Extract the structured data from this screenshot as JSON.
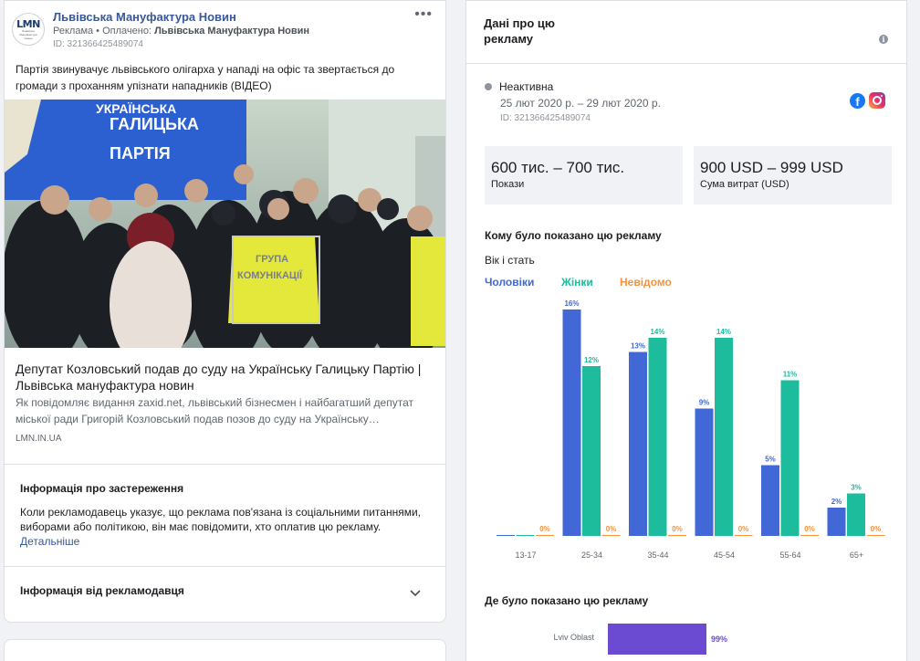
{
  "ad": {
    "page_name": "Львівська Мануфактура Новин",
    "sponsored_prefix": "Реклама • Оплачено: ",
    "paid_by": "Львівська Мануфактура Новин",
    "ad_id": "ID: 321366425489074",
    "logo_text": "LMN",
    "logo_subtext": "Львівська Мануфактура Новин",
    "more_icon": "more-horizontal-icon",
    "body": "Партія звинувачує львівського олігарха у нападі на офіс та звертається до громади з проханням упізнати нападників (ВІДЕО)",
    "image": {
      "banner_line1": "ГАЛИЦЬКА",
      "banner_line2": "ПАРТІЯ",
      "banner_top": "УКРАЇНСЬКА",
      "vest_line1": "ГРУПА",
      "vest_line2": "КОМУНІКАЦІЇ"
    },
    "link_title": "Депутат Козловський подав до суду на Українську Галицьку Партію | Львівська мануфактура новин",
    "link_description": "Як повідомляє видання zaxid.net, львівський бізнесмен і найбагатший депутат міської ради Григорій Козловський подав позов до суду на Українську…",
    "link_domain": "LMN.IN.UA"
  },
  "disclaimer": {
    "title": "Інформація про застереження",
    "text": "Коли рекламодавець указує, що реклама пов'язана із соціальними питаннями, виборами або політикою, він має повідомити, хто оплатив цю рекламу.",
    "link": "Детальніше"
  },
  "advertiser": {
    "title": "Інформація від рекламодавця",
    "chevron_icon": "chevron-down-icon"
  },
  "panel": {
    "title": "Дані про цю рекламу",
    "status": "Неактивна",
    "dates": "25 лют 2020 р. – 29 лют 2020 р.",
    "ad_id": "ID: 321366425489074",
    "platforms": [
      "facebook-icon",
      "instagram-icon"
    ],
    "impressions_value": "600 тис. – 700 тис.",
    "impressions_label": "Покази",
    "spend_value": "900 USD – 999 USD",
    "spend_label": "Сума витрат (USD)",
    "who_title": "Кому було показано цю рекламу",
    "age_gender_label": "Вік і стать",
    "where_title": "Де було показано цю рекламу"
  },
  "colors": {
    "men": "#4267d6",
    "women": "#1cbc9c",
    "unknown": "#f7923a",
    "region": "#6a4bd1"
  },
  "chart_data": {
    "type": "bar",
    "categories": [
      "13-17",
      "25-34",
      "35-44",
      "45-54",
      "55-64",
      "65+"
    ],
    "series": [
      {
        "name": "Чоловіки",
        "values": [
          0,
          16,
          13,
          9,
          5,
          2
        ],
        "labels": [
          "",
          "16%",
          "13%",
          "9%",
          "5%",
          "2%"
        ]
      },
      {
        "name": "Жінки",
        "values": [
          0,
          12,
          14,
          14,
          11,
          3
        ],
        "labels": [
          "",
          "12%",
          "14%",
          "14%",
          "11%",
          "3%"
        ]
      },
      {
        "name": "Невідомо",
        "values": [
          0,
          0,
          0,
          0,
          0,
          0
        ],
        "labels": [
          "0%",
          "0%",
          "0%",
          "0%",
          "0%",
          "0%"
        ]
      }
    ],
    "ylim": [
      0,
      16
    ],
    "grid": false,
    "legend": "top-left"
  },
  "region_data": {
    "type": "bar",
    "categories": [
      "Lviv Oblast"
    ],
    "values": [
      99
    ],
    "labels": [
      "99%"
    ]
  }
}
